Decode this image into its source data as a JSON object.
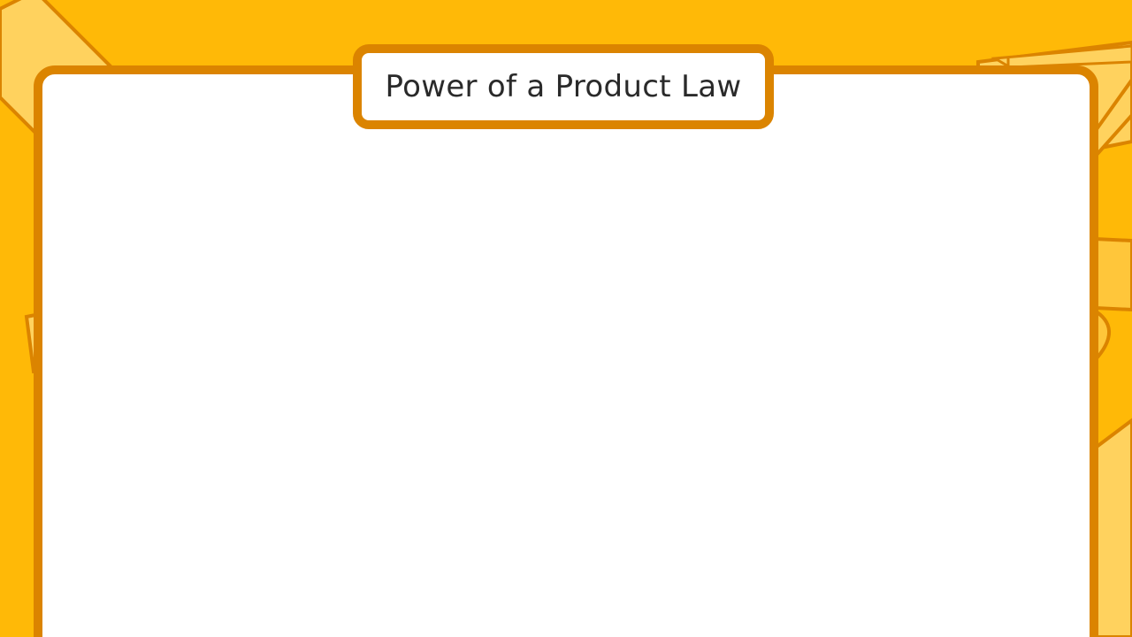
{
  "lesson": {
    "title": "Power of a Product Law"
  },
  "colors": {
    "background": "#FFB907",
    "accent_border": "#DB8400",
    "decor_fill": "#FFD25E",
    "card": "#FFFFFF",
    "title_text": "#2A2A2A"
  },
  "decorations": [
    "pencil-decoration",
    "eraser-decoration",
    "tape-roll-decoration",
    "notebook-decoration"
  ]
}
